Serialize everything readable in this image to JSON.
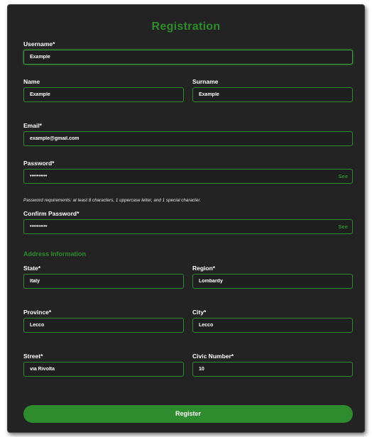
{
  "form": {
    "title": "Registration",
    "username": {
      "label": "Username*",
      "value": "Example"
    },
    "name": {
      "label": "Name",
      "value": "Example"
    },
    "surname": {
      "label": "Surname",
      "value": "Example"
    },
    "email": {
      "label": "Email*",
      "value": "example@gmail.com"
    },
    "password": {
      "label": "Password*",
      "value": "••••••••••",
      "toggle_label": "See"
    },
    "password_hint": "Password requirements: at least 8 characters, 1 uppercase letter, and 1 special character.",
    "confirm_password": {
      "label": "Confirm Password*",
      "value": "••••••••••",
      "toggle_label": "See"
    },
    "address_section_title": "Address Information",
    "state": {
      "label": "State*",
      "value": "Italy"
    },
    "region": {
      "label": "Region*",
      "value": "Lombardy"
    },
    "province": {
      "label": "Province*",
      "value": "Lecco"
    },
    "city": {
      "label": "City*",
      "value": "Lecco"
    },
    "street": {
      "label": "Street*",
      "value": "via Rivolta"
    },
    "civic_number": {
      "label": "Civic Number*",
      "value": "10"
    },
    "register_label": "Register"
  },
  "colors": {
    "accent": "#2e8b2e",
    "background": "#232323",
    "text": "#ffffff"
  }
}
